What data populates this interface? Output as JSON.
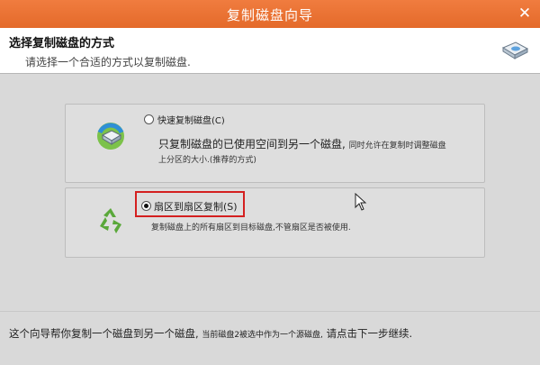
{
  "window": {
    "title": "复制磁盘向导",
    "close_glyph": "✕"
  },
  "header": {
    "title": "选择复制磁盘的方式",
    "subtitle": "请选择一个合适的方式以复制磁盘.",
    "logo_icon": "disk-copy-icon"
  },
  "options": [
    {
      "label": "快速复制磁盘(C)",
      "selected": false,
      "icon": "quick-copy-disk-icon",
      "desc_line1_main": "只复制磁盘的已使用空间到另一个磁盘,",
      "desc_line1_small": "同时允许在复制时调整磁盘",
      "desc_line2": "上分区的大小.(推荐的方式)"
    },
    {
      "label": "扇区到扇区复制(S)",
      "selected": true,
      "icon": "recycle-icon",
      "desc_line1": "复制磁盘上的所有扇区到目标磁盘,不管扇区是否被使用."
    }
  ],
  "footer": {
    "text_main": "这个向导帮你复制一个磁盘到另一个磁盘,",
    "text_small": "当前磁盘2被选中作为一个源磁盘,",
    "text_end": "请点击下一步继续."
  },
  "colors": {
    "titlebar": "#e46a2a",
    "highlight": "#d42020",
    "background": "#d9d9d9"
  }
}
